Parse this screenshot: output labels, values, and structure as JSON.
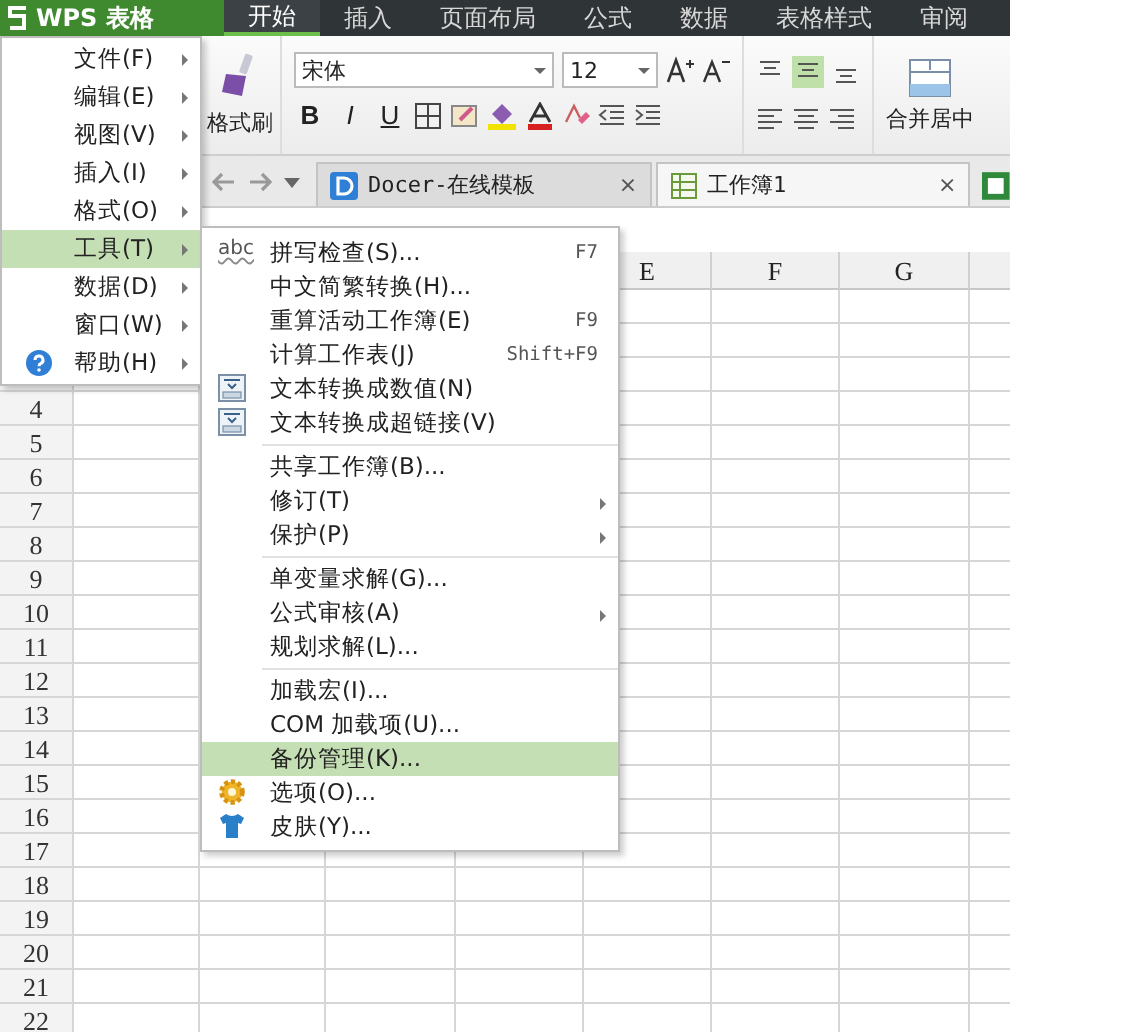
{
  "app": {
    "logo": "WPS 表格"
  },
  "ribbon_tabs": [
    {
      "label": "开始",
      "selected": true
    },
    {
      "label": "插入",
      "selected": false
    },
    {
      "label": "页面布局",
      "selected": false
    },
    {
      "label": "公式",
      "selected": false
    },
    {
      "label": "数据",
      "selected": false
    },
    {
      "label": "表格样式",
      "selected": false
    },
    {
      "label": "审阅",
      "selected": false
    }
  ],
  "ribbon": {
    "format_painter": "格式刷",
    "font": "宋体",
    "font_size": "12",
    "bold": "B",
    "italic": "I",
    "underline": "U",
    "merge_center": "合并居中"
  },
  "doc_tabs": [
    {
      "label": "Docer-在线模板",
      "kind": "docer",
      "selected": false,
      "close": "×"
    },
    {
      "label": "工作簿1",
      "kind": "sheet",
      "selected": true,
      "close": "×"
    }
  ],
  "sheet": {
    "columns": [
      "E",
      "F",
      "G"
    ],
    "rows": [
      "4",
      "5",
      "6",
      "7",
      "8",
      "9",
      "10",
      "11",
      "12",
      "13",
      "14",
      "15",
      "16",
      "17",
      "18",
      "19",
      "20",
      "21",
      "22"
    ]
  },
  "main_menu": [
    {
      "label": "文件(F)",
      "kind": "plain",
      "selected": false
    },
    {
      "label": "编辑(E)",
      "kind": "plain",
      "selected": false
    },
    {
      "label": "视图(V)",
      "kind": "plain",
      "selected": false
    },
    {
      "label": "插入(I)",
      "kind": "plain",
      "selected": false
    },
    {
      "label": "格式(O)",
      "kind": "plain",
      "selected": false
    },
    {
      "label": "工具(T)",
      "kind": "plain",
      "selected": true
    },
    {
      "label": "数据(D)",
      "kind": "plain",
      "selected": false
    },
    {
      "label": "窗口(W)",
      "kind": "plain",
      "selected": false
    },
    {
      "label": "帮助(H)",
      "kind": "help",
      "selected": false
    }
  ],
  "tools_menu": [
    [
      {
        "label": "拼写检查(S)...",
        "kind": "spell",
        "icon_text": "abc",
        "shortcut": "F7",
        "selected": false
      },
      {
        "label": "中文简繁转换(H)...",
        "kind": "plain",
        "selected": false
      },
      {
        "label": "重算活动工作簿(E)",
        "kind": "plain",
        "shortcut": "F9",
        "selected": false
      },
      {
        "label": "计算工作表(J)",
        "kind": "plain",
        "shortcut": "Shift+F9",
        "selected": false
      },
      {
        "label": "文本转换成数值(N)",
        "kind": "convert",
        "selected": false
      },
      {
        "label": "文本转换成超链接(V)",
        "kind": "convert",
        "selected": false
      }
    ],
    [
      {
        "label": "共享工作簿(B)...",
        "kind": "plain",
        "selected": false
      },
      {
        "label": "修订(T)",
        "kind": "submenu",
        "selected": false
      },
      {
        "label": "保护(P)",
        "kind": "submenu",
        "selected": false
      }
    ],
    [
      {
        "label": "单变量求解(G)...",
        "kind": "plain",
        "selected": false
      },
      {
        "label": "公式审核(A)",
        "kind": "submenu",
        "selected": false
      },
      {
        "label": "规划求解(L)...",
        "kind": "plain",
        "selected": false
      }
    ],
    [
      {
        "label": "加载宏(I)...",
        "kind": "plain",
        "selected": false
      },
      {
        "label": "COM 加载项(U)...",
        "kind": "plain",
        "selected": false
      },
      {
        "label": "备份管理(K)...",
        "kind": "plain",
        "selected": true
      },
      {
        "label": "选项(O)...",
        "kind": "options",
        "selected": false
      },
      {
        "label": "皮肤(Y)...",
        "kind": "skin",
        "selected": false
      }
    ]
  ]
}
